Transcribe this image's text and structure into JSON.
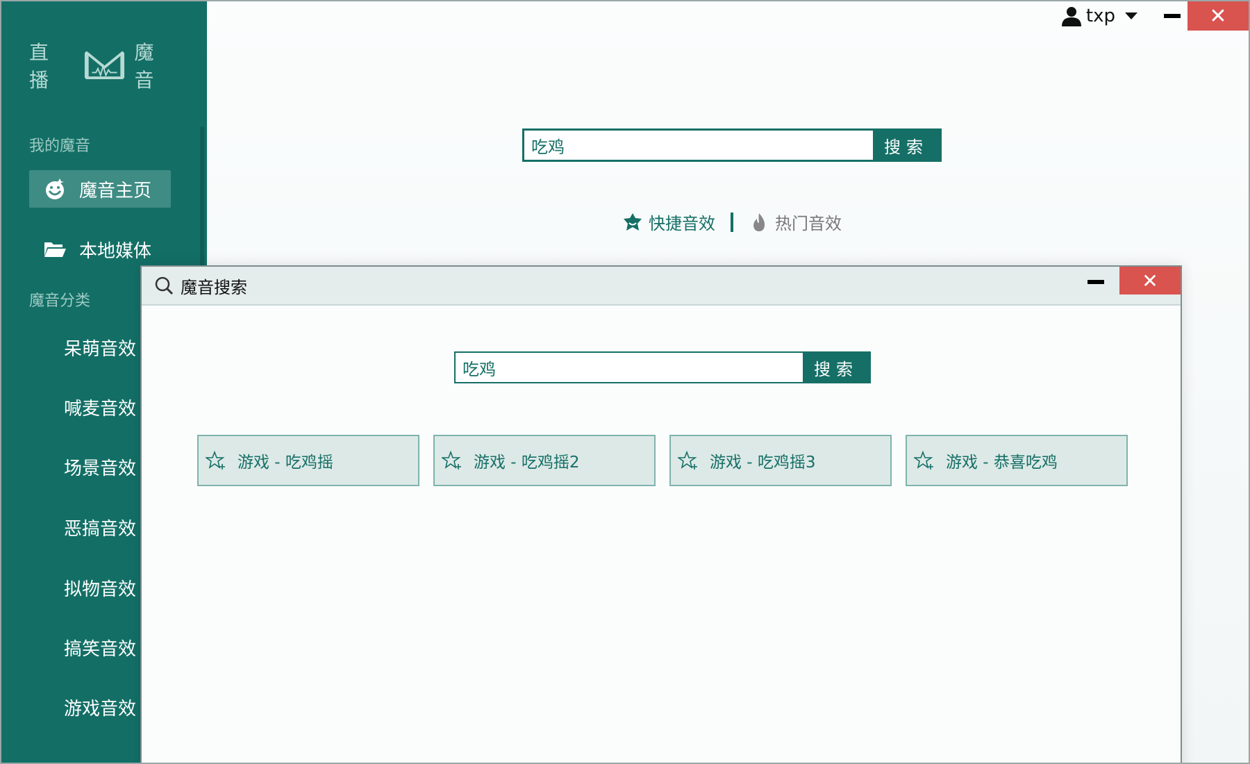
{
  "app": {
    "logo": {
      "left_text": "直播",
      "right_text": "魔音"
    },
    "user": {
      "name": "txp"
    }
  },
  "sidebar": {
    "section_mine": "我的魔音",
    "nav": [
      {
        "label": "魔音主页",
        "icon": "smile-face-icon",
        "active": true
      },
      {
        "label": "本地媒体",
        "icon": "folder-open-icon",
        "active": false
      }
    ],
    "section_categories": "魔音分类",
    "categories": [
      "呆萌音效",
      "喊麦音效",
      "场景音效",
      "恶搞音效",
      "拟物音效",
      "搞笑音效",
      "游戏音效"
    ]
  },
  "main": {
    "search": {
      "value": "吃鸡",
      "button": "搜索"
    },
    "tabs": [
      {
        "label": "快捷音效",
        "icon": "star-badge-icon",
        "active": true
      },
      {
        "label": "热门音效",
        "icon": "hot-flame-icon",
        "active": false
      }
    ]
  },
  "dialog": {
    "title": "魔音搜索",
    "search": {
      "value": "吃鸡",
      "button": "搜索"
    },
    "results": [
      {
        "label": "游戏 - 吃鸡摇"
      },
      {
        "label": "游戏 - 吃鸡摇2"
      },
      {
        "label": "游戏 - 吃鸡摇3"
      },
      {
        "label": "游戏 - 恭喜吃鸡"
      }
    ]
  },
  "colors": {
    "brand": "#136f66",
    "close": "#d9534f"
  }
}
